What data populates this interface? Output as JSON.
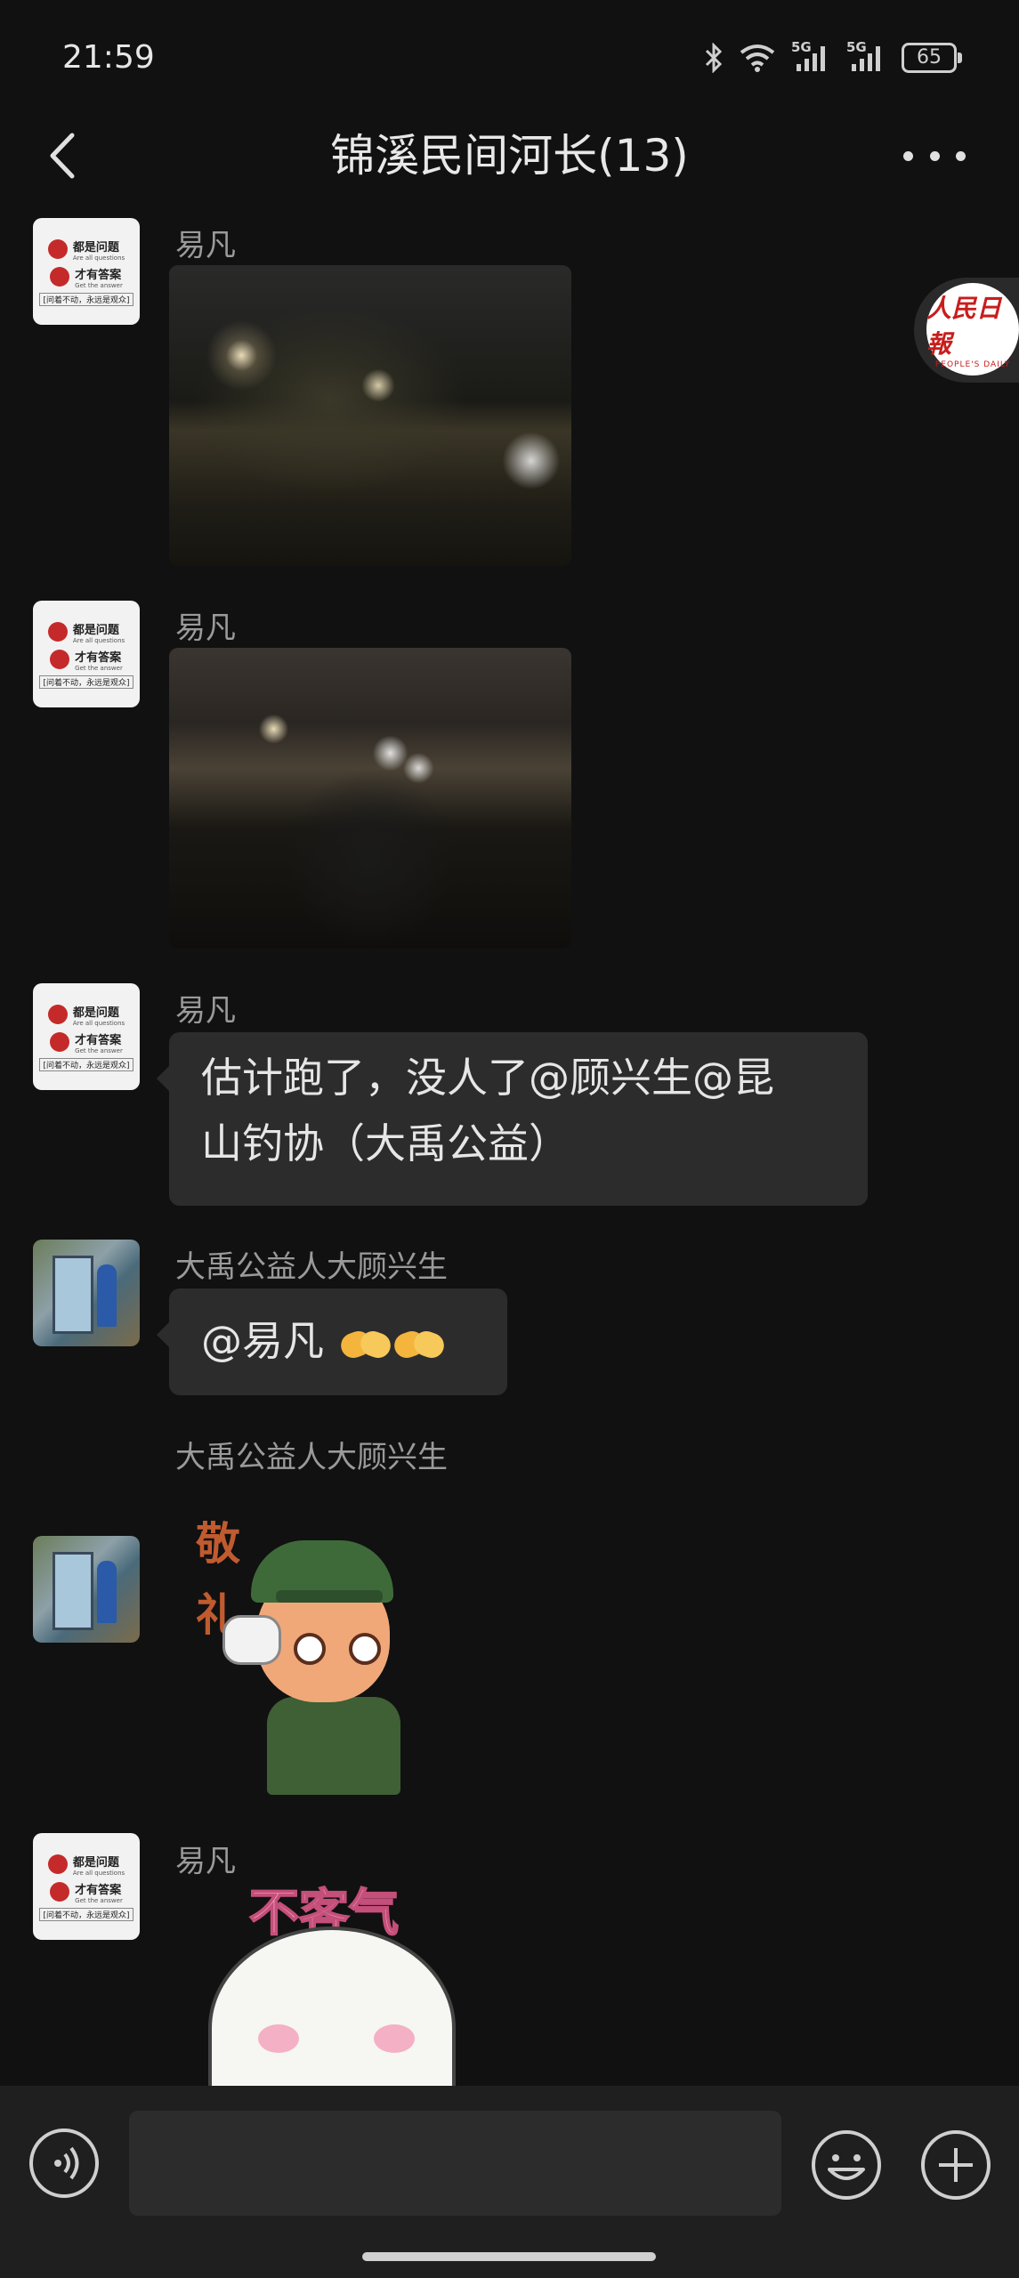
{
  "status_bar": {
    "time": "21:59",
    "signal1_label": "5G",
    "signal2_label": "5G",
    "battery": "65"
  },
  "header": {
    "title": "锦溪民间河长(13)",
    "back_icon": "chevron-left-icon",
    "more_icon": "more-dots-icon"
  },
  "floating_badge": {
    "text": "人民日報",
    "subtext": "PEOPLE'S DAILY"
  },
  "avatar_a": {
    "line1": "都是问题",
    "line1_en": "Are all questions",
    "line2": "才有答案",
    "line2_en": "Get the answer",
    "strip": "[问着不动，永远是观众]"
  },
  "messages": [
    {
      "sender": "易凡",
      "type": "image"
    },
    {
      "sender": "易凡",
      "type": "image"
    },
    {
      "sender": "易凡",
      "type": "text",
      "text_line1": "估计跑了，没人了@顾兴生@昆",
      "text_line2": "山钓协（大禹公益）"
    },
    {
      "sender": "大禹公益人大顾兴生",
      "type": "text",
      "text": "@易凡"
    },
    {
      "sender": "大禹公益人大顾兴生",
      "type": "sticker",
      "sticker_text": [
        "敬",
        "礼"
      ]
    },
    {
      "sender": "易凡",
      "type": "sticker",
      "sticker_text": "不客气"
    }
  ],
  "input_bar": {
    "placeholder": "",
    "voice_icon": "voice-icon",
    "emoji_icon": "emoji-icon",
    "plus_icon": "plus-icon"
  }
}
